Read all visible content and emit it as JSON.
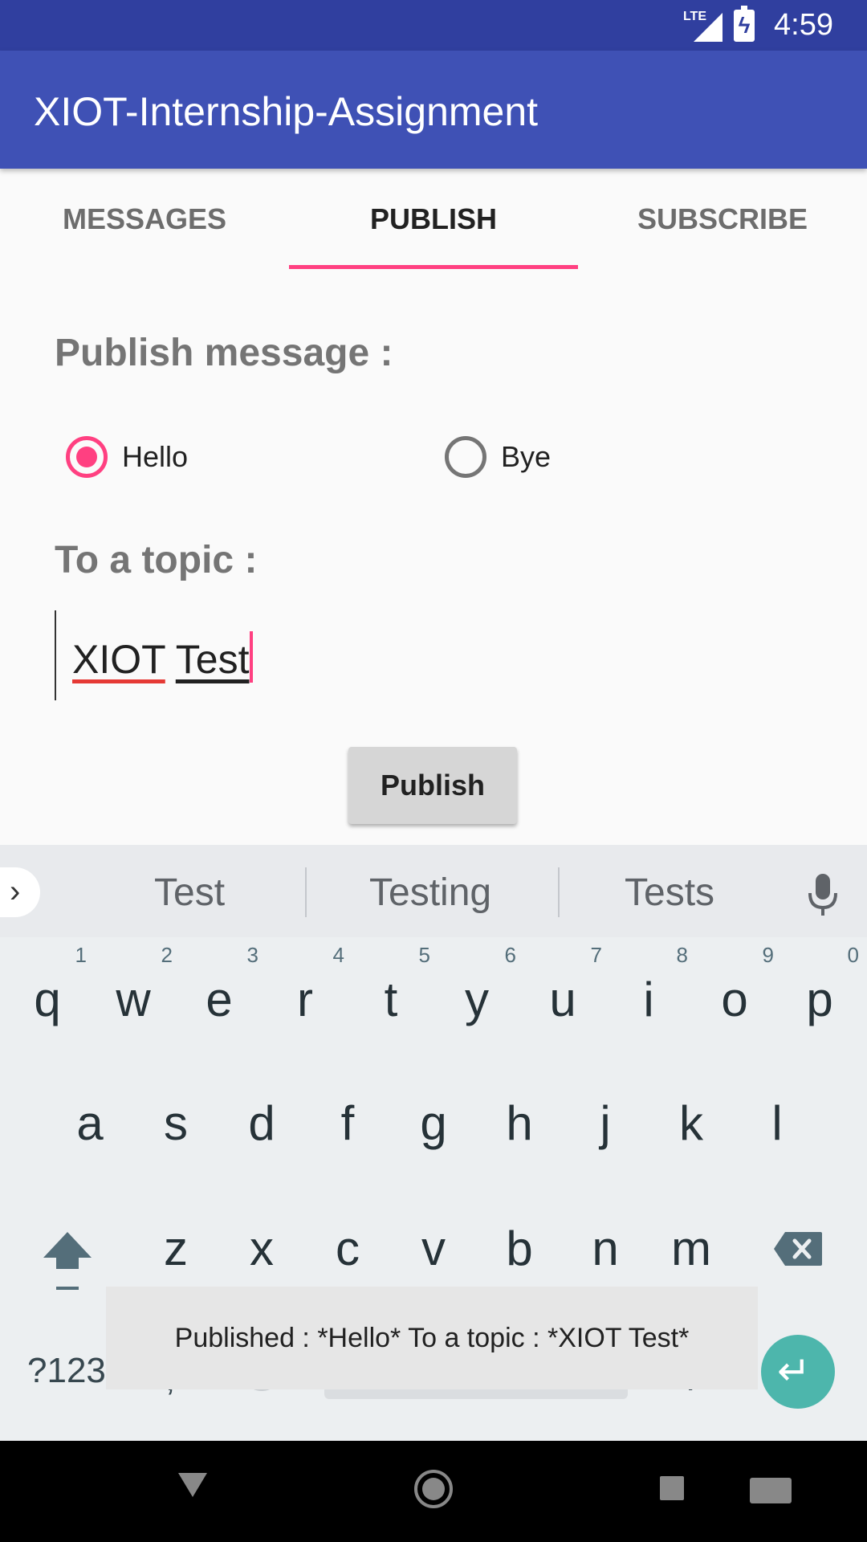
{
  "status_bar": {
    "time": "4:59",
    "network": "LTE",
    "icons": [
      "lte-signal-icon",
      "battery-charging-icon"
    ]
  },
  "app_bar": {
    "title": "XIOT-Internship-Assignment"
  },
  "tabs": [
    {
      "label": "MESSAGES",
      "active": false
    },
    {
      "label": "PUBLISH",
      "active": true
    },
    {
      "label": "SUBSCRIBE",
      "active": false
    }
  ],
  "publish_form": {
    "message_heading": "Publish message :",
    "options": [
      {
        "label": "Hello",
        "checked": true
      },
      {
        "label": "Bye",
        "checked": false
      }
    ],
    "topic_heading": "To a topic :",
    "topic_value_word1": "XIOT",
    "topic_value_word2": "Test",
    "publish_button": "Publish"
  },
  "keyboard": {
    "suggestions": [
      "Test",
      "Testing",
      "Tests"
    ],
    "row1": [
      "q",
      "w",
      "e",
      "r",
      "t",
      "y",
      "u",
      "i",
      "o",
      "p"
    ],
    "row1_hints": [
      "1",
      "2",
      "3",
      "4",
      "5",
      "6",
      "7",
      "8",
      "9",
      "0"
    ],
    "row2": [
      "a",
      "s",
      "d",
      "f",
      "g",
      "h",
      "j",
      "k",
      "l"
    ],
    "row3": [
      "z",
      "x",
      "c",
      "v",
      "b",
      "n",
      "m"
    ],
    "symbols_key": "?123",
    "comma_key": ",",
    "period_key": "."
  },
  "toast": {
    "text": "Published : *Hello* To a topic : *XIOT Test*"
  },
  "colors": {
    "primary": "#3F51B5",
    "primary_dark": "#303F9F",
    "accent": "#FF4081",
    "enter_key": "#4db6ac"
  }
}
